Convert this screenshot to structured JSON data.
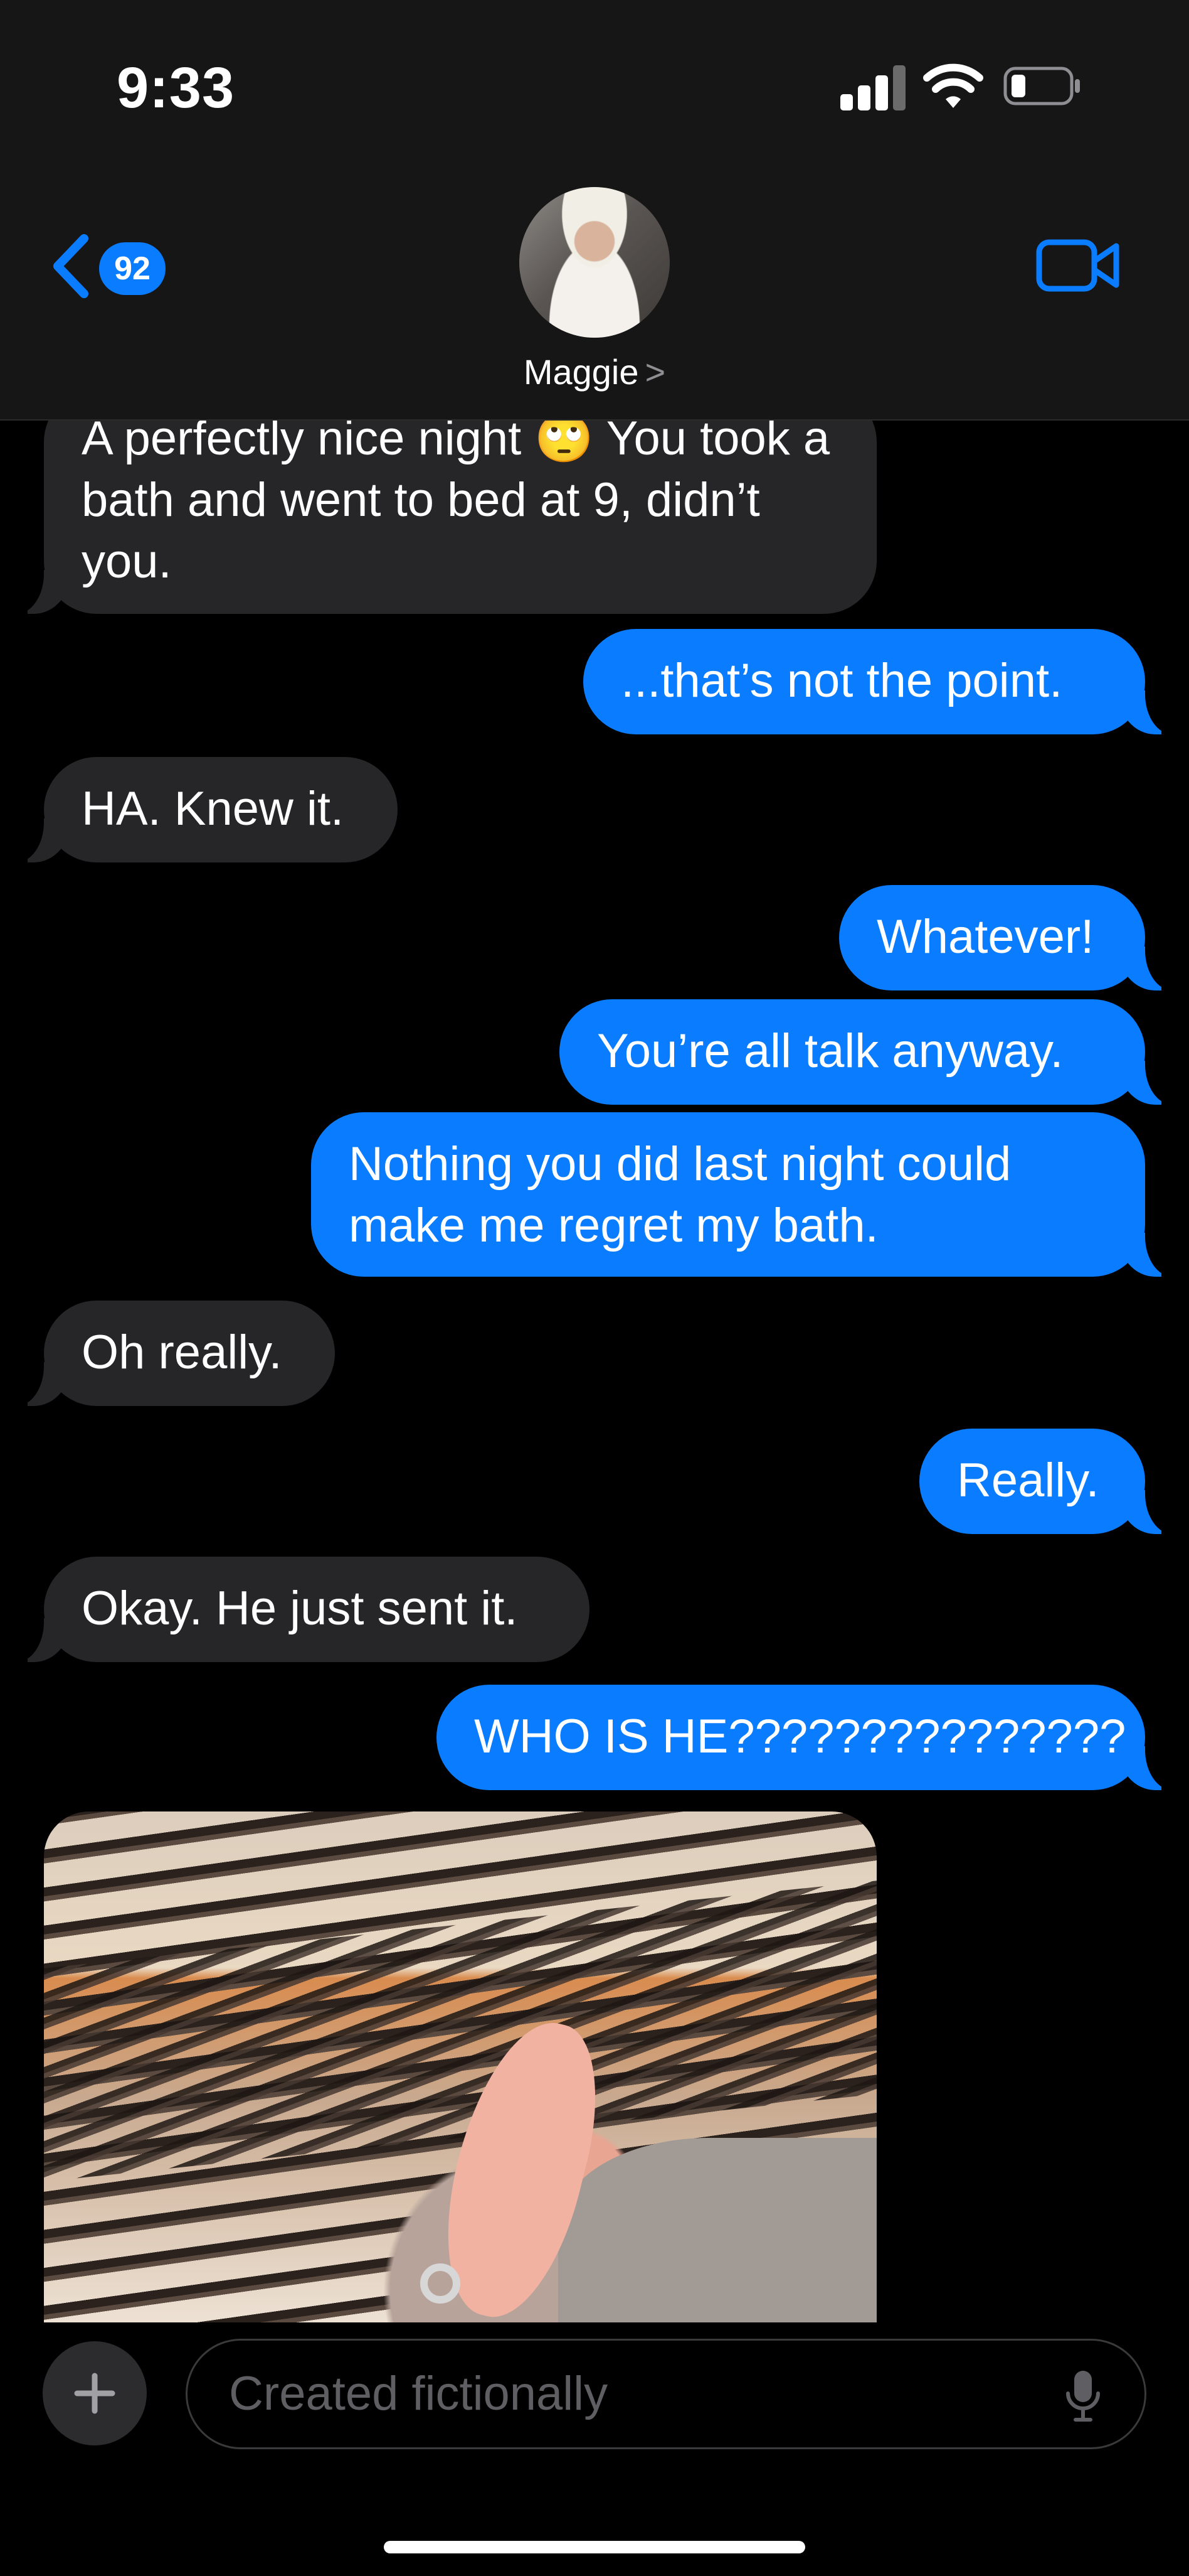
{
  "status_bar": {
    "time": "9:33"
  },
  "header": {
    "back_badge": "92",
    "contact_name": "Maggie",
    "contact_chevron": ">"
  },
  "messages": [
    {
      "direction": "incoming",
      "text": "A perfectly nice night 🙄 You took a bath and went to bed at 9, didn’t you."
    },
    {
      "direction": "outgoing",
      "text": "...that’s not the point."
    },
    {
      "direction": "incoming",
      "text": "HA. Knew it."
    },
    {
      "direction": "outgoing",
      "text": "Whatever!"
    },
    {
      "direction": "outgoing",
      "text": "You’re all talk anyway."
    },
    {
      "direction": "outgoing",
      "text": "Nothing you did last night could make me regret my bath."
    },
    {
      "direction": "incoming",
      "text": "Oh really."
    },
    {
      "direction": "outgoing",
      "text": "Really."
    },
    {
      "direction": "incoming",
      "text": "Okay. He just sent it."
    },
    {
      "direction": "outgoing",
      "text": "WHO IS HE???????????????"
    },
    {
      "direction": "incoming",
      "type": "photo"
    }
  ],
  "compose": {
    "placeholder": "Created fictionally",
    "plus_label": "+"
  },
  "colors": {
    "outgoing_bubble": "#0a7cff",
    "incoming_bubble": "#262628",
    "background": "#000000",
    "header": "#161616"
  }
}
